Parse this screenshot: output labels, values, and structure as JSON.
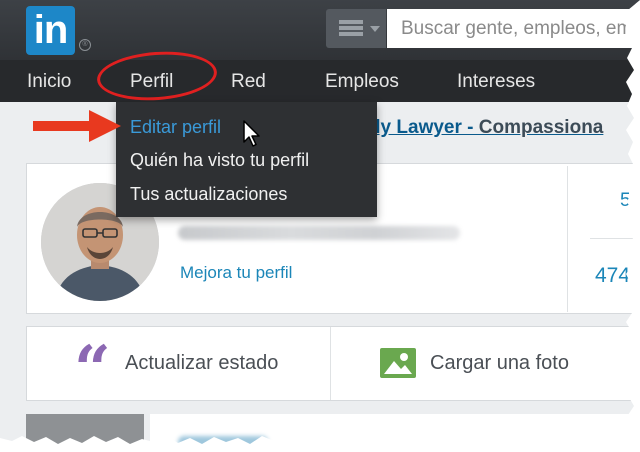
{
  "header": {
    "logo_text": "in",
    "logo_color": "#1d87c8",
    "search_menu_icon": "list-menu-icon",
    "search_placeholder": "Buscar gente, empleos, em"
  },
  "nav": {
    "items": [
      {
        "label": "Inicio"
      },
      {
        "label": "Perfil"
      },
      {
        "label": "Red"
      },
      {
        "label": "Empleos"
      },
      {
        "label": "Intereses"
      }
    ]
  },
  "profile_menu": {
    "items": [
      {
        "label": "Editar perfil",
        "highlighted": true
      },
      {
        "label": "Quién ha visto tu perfil"
      },
      {
        "label": "Tus actualizaciones"
      }
    ]
  },
  "headline": {
    "part1": "ily Lawyer -",
    "part2": " Compassiona"
  },
  "profile_card": {
    "improve_link": "Mejora tu perfil",
    "stat_top": "5",
    "stat_bottom": "474"
  },
  "share_bar": {
    "update_label": "Actualizar estado",
    "update_icon": "quote-icon",
    "photo_label": "Cargar una foto",
    "photo_icon": "image-icon"
  },
  "annotations": {
    "highlight_color": "#e02020",
    "arrow_color": "#e8391f"
  }
}
